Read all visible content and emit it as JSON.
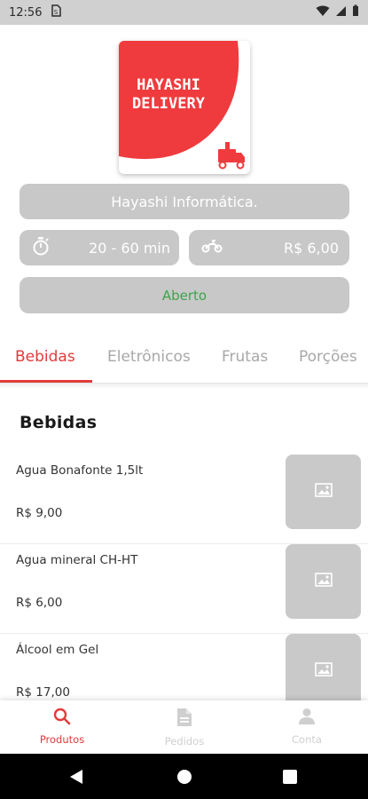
{
  "status_bar": {
    "time": "12:56"
  },
  "store": {
    "logo_text_line1": "HAYASHI",
    "logo_text_line2": "DELIVERY",
    "name": "Hayashi Informática.",
    "delivery_time": "20 - 60 min",
    "delivery_fee": "R$ 6,00",
    "status": "Aberto"
  },
  "tabs": [
    {
      "label": "Bebidas",
      "active": true
    },
    {
      "label": "Eletrônicos",
      "active": false
    },
    {
      "label": "Frutas",
      "active": false
    },
    {
      "label": "Porções",
      "active": false
    }
  ],
  "section": {
    "title": "Bebidas"
  },
  "products": [
    {
      "name": "Agua Bonafonte 1,5lt",
      "price": "R$ 9,00"
    },
    {
      "name": "Agua mineral CH-HT",
      "price": "R$ 6,00"
    },
    {
      "name": "Álcool em Gel",
      "price": "R$ 17,00"
    }
  ],
  "bottom_nav": [
    {
      "label": "Produtos",
      "icon": "search-icon",
      "active": true
    },
    {
      "label": "Pedidos",
      "icon": "document-icon",
      "active": false
    },
    {
      "label": "Conta",
      "icon": "person-icon",
      "active": false
    }
  ],
  "colors": {
    "accent": "#e23b3b",
    "open_status": "#3fa34d",
    "pill_bg": "#c8c8c8"
  }
}
